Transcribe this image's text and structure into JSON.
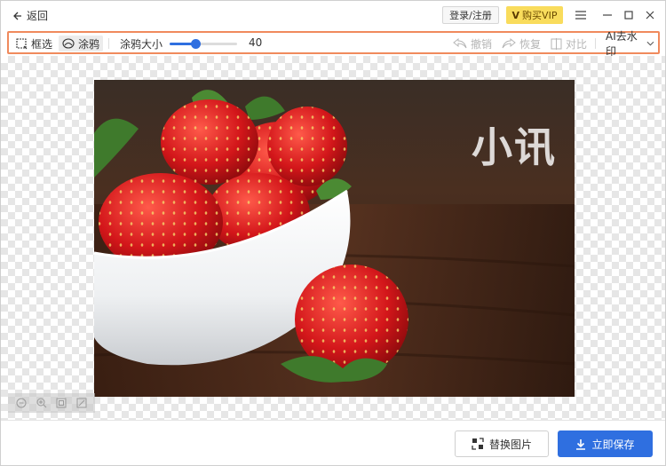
{
  "titlebar": {
    "back_label": "返回",
    "login_label": "登录/注册",
    "vip_mark": "V",
    "vip_label": "购买VIP"
  },
  "toolbar": {
    "select_label": "框选",
    "brush_label": "涂鸦",
    "size_label": "涂鸦大小",
    "size_value": "40",
    "size_fraction": 0.38,
    "undo_label": "撤销",
    "redo_label": "恢复",
    "compare_label": "对比",
    "mode_label": "AI去水印"
  },
  "canvas": {
    "watermark_text": "小讯"
  },
  "footer": {
    "replace_label": "替换图片",
    "save_label": "立即保存"
  },
  "colors": {
    "accent": "#2f6fe0",
    "toolbar_border": "#f08a5d",
    "vip": "#f9dc5c"
  }
}
